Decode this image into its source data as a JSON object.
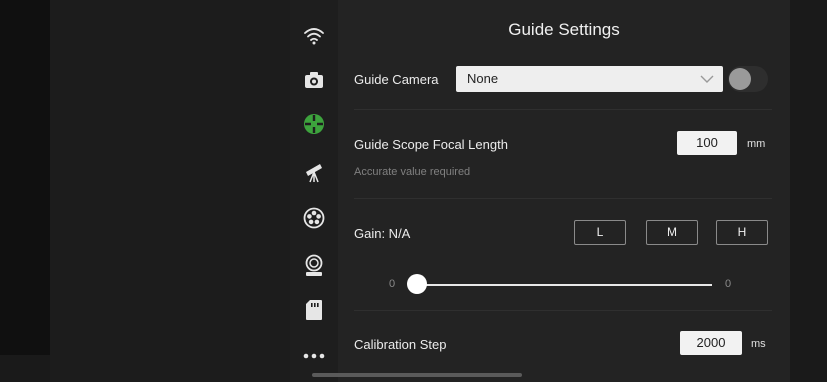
{
  "panel": {
    "title": "Guide Settings",
    "guide_camera": {
      "label": "Guide Camera",
      "value": "None",
      "enabled": false
    },
    "focal_length": {
      "label": "Guide Scope Focal Length",
      "hint": "Accurate value required",
      "value": "100",
      "unit": "mm"
    },
    "gain": {
      "label": "Gain: N/A",
      "presets": [
        "L",
        "M",
        "H"
      ],
      "slider": {
        "min_label": "0",
        "max_label": "0",
        "value": 0
      }
    },
    "calibration": {
      "label": "Calibration Step",
      "value": "2000",
      "unit": "ms"
    }
  },
  "rail": {
    "icons": [
      "wifi-icon",
      "camera-icon",
      "guide-icon",
      "telescope-icon",
      "filter-wheel-icon",
      "focuser-icon",
      "storage-card-icon",
      "more-icon"
    ],
    "active": "guide-icon"
  },
  "colors": {
    "accent": "#3da33d",
    "panel_bg": "#232323",
    "rail_bg": "#1e1e1e"
  }
}
